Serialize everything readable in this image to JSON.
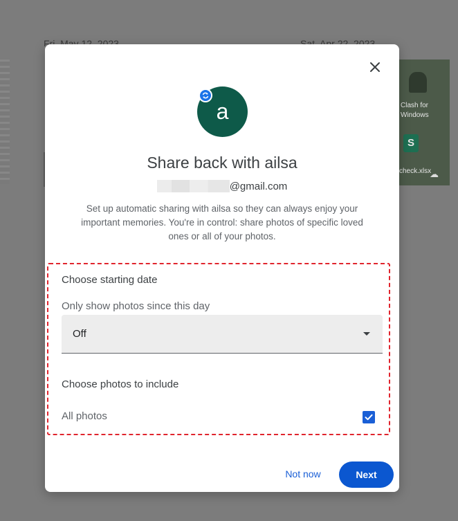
{
  "background": {
    "date_left": "Fri, May 12, 2023",
    "date_right": "Sat, Apr 22, 2023",
    "desktop_app_label": "Clash for Windows",
    "desktop_file_label": "check.xlsx",
    "desktop_sheet_letter": "S"
  },
  "dialog": {
    "avatar_letter": "a",
    "title": "Share back with ailsa",
    "email_suffix": "@gmail.com",
    "description": "Set up automatic sharing with ailsa so they can always enjoy your important memories. You're in control: share photos of specific loved ones or all of your photos.",
    "starting_date": {
      "heading": "Choose starting date",
      "field_label": "Only show photos since this day",
      "selected_value": "Off"
    },
    "include": {
      "heading": "Choose photos to include",
      "all_photos_label": "All photos",
      "all_photos_checked": true
    },
    "buttons": {
      "not_now": "Not now",
      "next": "Next"
    }
  },
  "colors": {
    "accent_blue": "#0b57d0",
    "avatar_green": "#0e5a49",
    "highlight_red": "#e0242d"
  }
}
